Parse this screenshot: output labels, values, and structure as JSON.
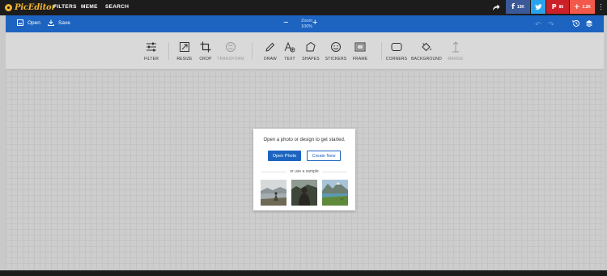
{
  "brand": {
    "name": "PicEditor"
  },
  "nav": {
    "filters": "FILTERS",
    "meme": "MEME",
    "search": "SEARCH"
  },
  "social": {
    "facebook": {
      "icon": "facebook-icon",
      "count": "13K",
      "color": "#3b5998"
    },
    "twitter": {
      "icon": "twitter-icon",
      "color": "#2aa3ef"
    },
    "pinterest": {
      "icon": "pinterest-icon",
      "count": "86",
      "color": "#cb2027"
    },
    "addthis": {
      "icon": "plus-icon",
      "count": "2.2K",
      "color": "#f2594b"
    }
  },
  "actionbar": {
    "open_label": "Open",
    "save_label": "Save",
    "zoom_label": "Zoom",
    "zoom_value": "100%"
  },
  "toolbar": {
    "filter": "FILTER",
    "resize": "RESIZE",
    "crop": "CROP",
    "transform": "TRANSFORM",
    "draw": "DRAW",
    "text": "TEXT",
    "shapes": "SHAPES",
    "stickers": "STICKERS",
    "frame": "FRAME",
    "corners": "CORNERS",
    "background": "BACKGROUND",
    "merge": "MERGE"
  },
  "dialog": {
    "title": "Open a photo or design to get started.",
    "open_photo": "Open Photo",
    "create_new": "Create New",
    "sample_text": "or use a sample"
  },
  "colors": {
    "accent": "#1d64c1",
    "brand": "#f2b632",
    "topbar": "#1c1c1c"
  }
}
